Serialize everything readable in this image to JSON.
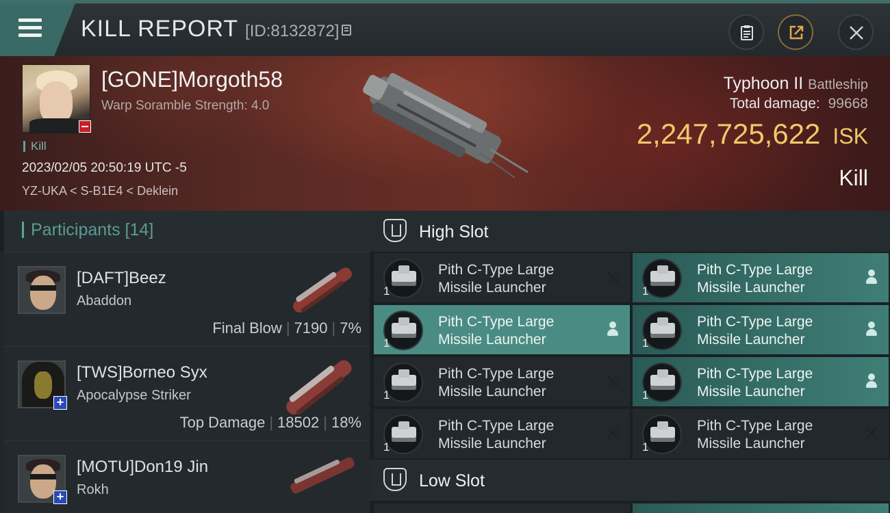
{
  "header": {
    "title": "KILL REPORT",
    "report_id": "[ID:8132872]"
  },
  "victim": {
    "name": "[GONE]Morgoth58",
    "warp_scramble": "Warp Soramble Strength: 4.0",
    "kill_label": "Kill",
    "timestamp": "2023/02/05 20:50:19 UTC -5",
    "location": "YZ-UKA < S-B1E4 < Deklein",
    "ship": "Typhoon II",
    "ship_class": "Battleship",
    "total_damage_label": "Total damage:",
    "total_damage": "99668",
    "isk_value": "2,247,725,622",
    "isk_unit": "ISK",
    "result": "Kill"
  },
  "participants": {
    "label": "Participants [14]",
    "items": [
      {
        "name": "[DAFT]Beez",
        "ship": "Abaddon",
        "role": "Final Blow",
        "damage": "7190",
        "percent": "7%"
      },
      {
        "name": "[TWS]Borneo Syx",
        "ship": "Apocalypse Striker",
        "role": "Top Damage",
        "damage": "18502",
        "percent": "18%"
      },
      {
        "name": "[MOTU]Don19 Jin",
        "ship": "Rokh",
        "role": "",
        "damage": "",
        "percent": ""
      }
    ]
  },
  "slots": {
    "high_label": "High Slot",
    "low_label": "Low Slot",
    "high_items": [
      {
        "line1": "Pith C-Type Large",
        "line2": "Missile Launcher",
        "qty": "1",
        "status": "destroyed"
      },
      {
        "line1": "Pith C-Type Large",
        "line2": "Missile Launcher",
        "qty": "1",
        "status": "dropped"
      },
      {
        "line1": "Pith C-Type Large",
        "line2": "Missile Launcher",
        "qty": "1",
        "status": "dropped"
      },
      {
        "line1": "Pith C-Type Large",
        "line2": "Missile Launcher",
        "qty": "1",
        "status": "dropped"
      },
      {
        "line1": "Pith C-Type Large",
        "line2": "Missile Launcher",
        "qty": "1",
        "status": "destroyed"
      },
      {
        "line1": "Pith C-Type Large",
        "line2": "Missile Launcher",
        "qty": "1",
        "status": "dropped"
      },
      {
        "line1": "Pith C-Type Large",
        "line2": "Missile Launcher",
        "qty": "1",
        "status": "destroyed"
      },
      {
        "line1": "Pith C-Type Large",
        "line2": "Missile Launcher",
        "qty": "1",
        "status": "destroyed"
      }
    ]
  },
  "colors": {
    "accent_teal": "#3a6a65",
    "isk_gold": "#f2c86a",
    "dropped_teal": "#4a8c83"
  }
}
